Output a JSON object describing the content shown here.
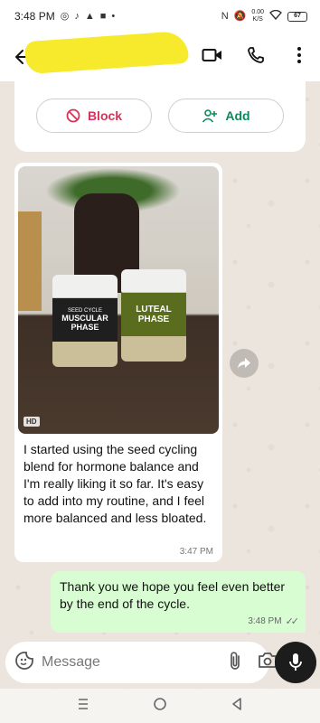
{
  "status_bar": {
    "time": "3:48 PM",
    "net_speed_top": "0.00",
    "net_speed_bottom": "K/S",
    "battery": "67"
  },
  "app_bar": {
    "contact_name_redacted": true,
    "icons": [
      "back-arrow-icon",
      "video-call-icon",
      "voice-call-icon",
      "more-vert-icon"
    ]
  },
  "contact_card": {
    "block_label": "Block",
    "add_label": "Add"
  },
  "messages": {
    "incoming": {
      "photo_badge": "HD",
      "product_1": "MUSCULAR PHASE",
      "product_1_sub": "SEED CYCLE",
      "product_2": "LUTEAL PHASE",
      "text": "I started using the seed cycling blend for hormone balance and I'm really liking it so far. It's easy to add into my routine, and I feel more balanced and less bloated.",
      "time": "3:47 PM"
    },
    "outgoing": {
      "text": "Thank you we hope you feel even better by the end of the cycle.",
      "time": "3:48 PM"
    }
  },
  "composer": {
    "placeholder": "Message"
  },
  "colors": {
    "block": "#d6335a",
    "add": "#0b8a5a",
    "outgoing_bubble": "#d9fdd3"
  }
}
